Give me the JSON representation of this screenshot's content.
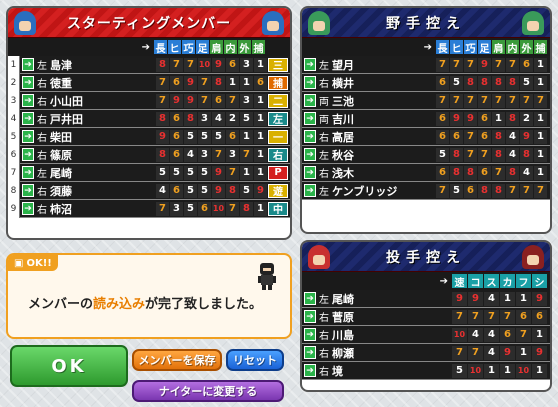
{
  "lineup": {
    "title": "スターティングメンバー",
    "headers": [
      "長",
      "ヒ",
      "巧",
      "足",
      "肩",
      "内",
      "外",
      "捕"
    ],
    "rows": [
      {
        "num": "1",
        "hand": "左",
        "name": "島津",
        "stats": [
          "8",
          "7",
          "7",
          "10",
          "9",
          "6",
          "3",
          "1"
        ],
        "pos": "三",
        "pos_color": "#d9b000"
      },
      {
        "num": "2",
        "hand": "右",
        "name": "徳重",
        "stats": [
          "7",
          "6",
          "9",
          "7",
          "8",
          "1",
          "1",
          "6"
        ],
        "pos": "捕",
        "pos_color": "#e06a00"
      },
      {
        "num": "3",
        "hand": "右",
        "name": "小山田",
        "stats": [
          "7",
          "9",
          "9",
          "7",
          "6",
          "7",
          "3",
          "1"
        ],
        "pos": "二",
        "pos_color": "#d9b000"
      },
      {
        "num": "4",
        "hand": "右",
        "name": "戸井田",
        "stats": [
          "8",
          "6",
          "8",
          "3",
          "4",
          "2",
          "5",
          "1"
        ],
        "pos": "左",
        "pos_color": "#1a8a8a"
      },
      {
        "num": "5",
        "hand": "右",
        "name": "柴田",
        "stats": [
          "9",
          "6",
          "5",
          "5",
          "5",
          "6",
          "1",
          "1"
        ],
        "pos": "一",
        "pos_color": "#d9b000"
      },
      {
        "num": "6",
        "hand": "右",
        "name": "篠原",
        "stats": [
          "8",
          "6",
          "4",
          "3",
          "7",
          "3",
          "7",
          "1"
        ],
        "pos": "右",
        "pos_color": "#1a8a8a"
      },
      {
        "num": "7",
        "hand": "左",
        "name": "尾崎",
        "stats": [
          "5",
          "5",
          "5",
          "5",
          "9",
          "7",
          "1",
          "1"
        ],
        "pos": "P",
        "pos_color": "#d42020"
      },
      {
        "num": "8",
        "hand": "右",
        "name": "須藤",
        "stats": [
          "4",
          "6",
          "5",
          "5",
          "9",
          "8",
          "5",
          "9"
        ],
        "pos": "遊",
        "pos_color": "#d9b000"
      },
      {
        "num": "9",
        "hand": "右",
        "name": "柿沼",
        "stats": [
          "7",
          "3",
          "5",
          "6",
          "10",
          "7",
          "8",
          "1"
        ],
        "pos": "中",
        "pos_color": "#1a8a8a"
      }
    ]
  },
  "fielders": {
    "title": "野手控え",
    "headers": [
      "長",
      "ヒ",
      "巧",
      "足",
      "肩",
      "内",
      "外",
      "捕"
    ],
    "rows": [
      {
        "hand": "左",
        "name": "望月",
        "stats": [
          "7",
          "7",
          "7",
          "9",
          "7",
          "7",
          "6",
          "1"
        ]
      },
      {
        "hand": "右",
        "name": "横井",
        "stats": [
          "6",
          "5",
          "8",
          "8",
          "8",
          "8",
          "5",
          "1"
        ]
      },
      {
        "hand": "両",
        "name": "三池",
        "stats": [
          "7",
          "7",
          "7",
          "7",
          "7",
          "7",
          "7",
          "7"
        ]
      },
      {
        "hand": "両",
        "name": "吉川",
        "stats": [
          "6",
          "9",
          "9",
          "6",
          "1",
          "8",
          "2",
          "1"
        ]
      },
      {
        "hand": "右",
        "name": "高居",
        "stats": [
          "6",
          "6",
          "7",
          "6",
          "8",
          "4",
          "9",
          "1"
        ]
      },
      {
        "hand": "左",
        "name": "秋谷",
        "stats": [
          "5",
          "8",
          "7",
          "7",
          "8",
          "4",
          "8",
          "1"
        ]
      },
      {
        "hand": "右",
        "name": "浅木",
        "stats": [
          "6",
          "8",
          "8",
          "6",
          "7",
          "8",
          "4",
          "1"
        ]
      },
      {
        "hand": "左",
        "name": "ケンブリッジ",
        "stats": [
          "7",
          "5",
          "6",
          "8",
          "8",
          "7",
          "7",
          "7"
        ]
      }
    ]
  },
  "pitchers": {
    "title": "投手控え",
    "headers": [
      "速",
      "コ",
      "ス",
      "カ",
      "フ",
      "シ"
    ],
    "rows": [
      {
        "hand": "左",
        "name": "尾崎",
        "stats": [
          "9",
          "9",
          "4",
          "1",
          "1",
          "9"
        ]
      },
      {
        "hand": "右",
        "name": "菅原",
        "stats": [
          "7",
          "7",
          "7",
          "7",
          "6",
          "6"
        ]
      },
      {
        "hand": "右",
        "name": "川島",
        "stats": [
          "10",
          "4",
          "4",
          "6",
          "7",
          "1"
        ]
      },
      {
        "hand": "右",
        "name": "柳瀬",
        "stats": [
          "7",
          "7",
          "4",
          "9",
          "1",
          "9"
        ]
      },
      {
        "hand": "右",
        "name": "境",
        "stats": [
          "5",
          "10",
          "1",
          "1",
          "10",
          "1"
        ]
      }
    ]
  },
  "message": {
    "tag": "OK!!",
    "before": "メンバーの",
    "highlight": "読み込み",
    "after": "が完了致しました。"
  },
  "buttons": {
    "ok": "OK",
    "save": "メンバーを保存",
    "reset": "リセット",
    "night": "ナイターに変更する"
  },
  "colors": {
    "red_header": "#d42020",
    "navy_header": "#1e2a6e",
    "stat_blue": "#2a7ed6",
    "stat_green": "#3a9a3a",
    "stat_teal": "#1aa0a6",
    "val_high": "#e83030",
    "val_mid": "#f0a020",
    "val_low": "#ffffff"
  }
}
